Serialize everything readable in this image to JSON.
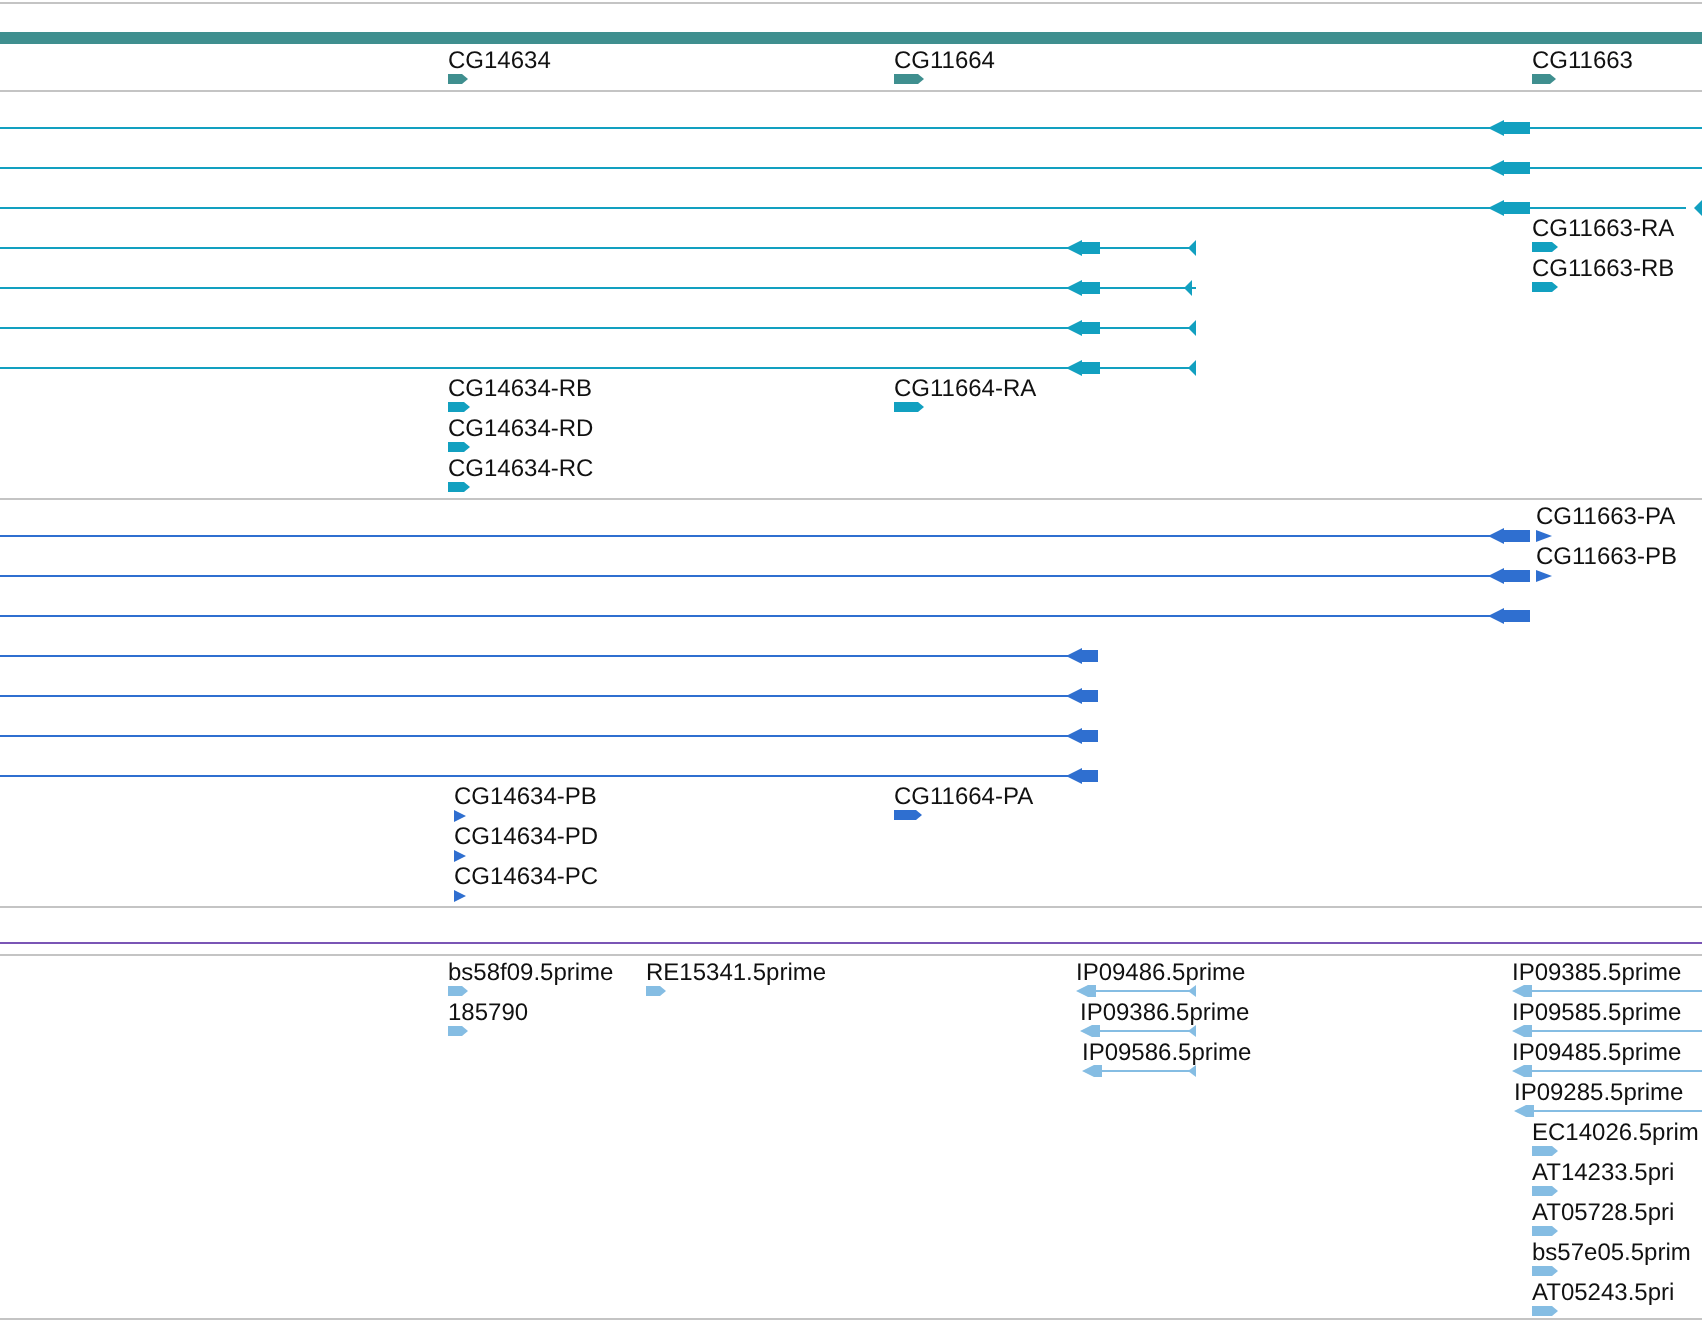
{
  "tracks": [
    {
      "kind": "gene",
      "features": [
        {
          "label": "CG14634"
        },
        {
          "label": "CG11664"
        },
        {
          "label": "CG11663"
        }
      ]
    },
    {
      "kind": "transcript",
      "features": [
        {
          "label": "CG11663-RA"
        },
        {
          "label": "CG11663-RB"
        },
        {
          "label": "CG14634-RB"
        },
        {
          "label": "CG14634-RD"
        },
        {
          "label": "CG14634-RC"
        },
        {
          "label": "CG11664-RA"
        }
      ]
    },
    {
      "kind": "protein",
      "features": [
        {
          "label": "CG11663-PA"
        },
        {
          "label": "CG11663-PB"
        },
        {
          "label": "CG14634-PB"
        },
        {
          "label": "CG14634-PD"
        },
        {
          "label": "CG14634-PC"
        },
        {
          "label": "CG11664-PA"
        }
      ]
    },
    {
      "kind": "est",
      "features": [
        {
          "label": "bs58f09.5prime"
        },
        {
          "label": "RE15341.5prime"
        },
        {
          "label": "185790"
        },
        {
          "label": "IP09486.5prime"
        },
        {
          "label": "IP09386.5prime"
        },
        {
          "label": "IP09586.5prime"
        },
        {
          "label": "IP09385.5prime"
        },
        {
          "label": "IP09585.5prime"
        },
        {
          "label": "IP09485.5prime"
        },
        {
          "label": "IP09285.5prime"
        },
        {
          "label": "EC14026.5prim"
        },
        {
          "label": "AT14233.5pri"
        },
        {
          "label": "AT05728.5pri"
        },
        {
          "label": "bs57e05.5prim"
        },
        {
          "label": "AT05243.5pri"
        }
      ]
    }
  ]
}
